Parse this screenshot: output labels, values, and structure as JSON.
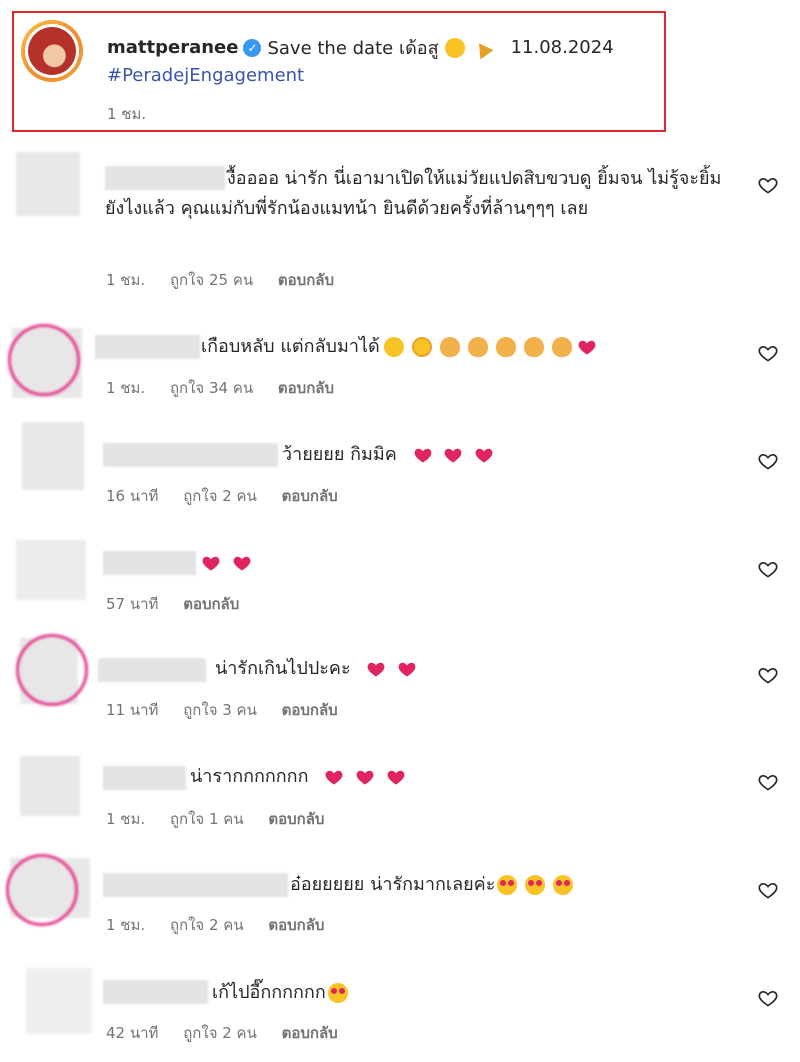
{
  "post": {
    "username": "mattperanee",
    "caption": "Save the date เด้อสู",
    "date": "11.08.2024",
    "hashtag": "#PeradejEngagement",
    "time": "1 ชม."
  },
  "comments": [
    {
      "text": "งื้ออออ น่ารัก นี่เอามาเปิดให้แม่วัยแปดสิบขวบดู ยิ้มจน ไม่รู้จะยิ้มยังไงแล้ว คุณแม่กับพี่รักน้องแมทน้า ยินดีด้วยครั้งที่ล้านๆๆๆ เลย",
      "time": "1 ชม.",
      "likes": "ถูกใจ 25 คน",
      "reply": "ตอบกลับ"
    },
    {
      "text": "เกือบหลับ แต่กลับมาได้",
      "time": "1 ชม.",
      "likes": "ถูกใจ 34 คน",
      "reply": "ตอบกลับ"
    },
    {
      "text": "ว้ายยยย กิมมิค",
      "time": "16 นาที",
      "likes": "ถูกใจ 2 คน",
      "reply": "ตอบกลับ"
    },
    {
      "text": "",
      "time": "57 นาที",
      "likes": "",
      "reply": "ตอบกลับ"
    },
    {
      "text": "น่ารักเกินไปปะคะ",
      "time": "11 นาที",
      "likes": "ถูกใจ 3 คน",
      "reply": "ตอบกลับ"
    },
    {
      "text": "น่ารากกกกกกก",
      "time": "1 ชม.",
      "likes": "ถูกใจ 1 คน",
      "reply": "ตอบกลับ"
    },
    {
      "text": "อ๋อยยยยย น่ารักมากเลยค่ะ",
      "time": "1 ชม.",
      "likes": "ถูกใจ 2 คน",
      "reply": "ตอบกลับ"
    },
    {
      "text": "เก้ไปอี๊กกกกกก",
      "time": "42 นาที",
      "likes": "ถูกใจ 2 คน",
      "reply": "ตอบกลับ"
    }
  ],
  "colors": {
    "heart": "#e0245e",
    "link": "#3a55a7",
    "highlight_border": "#e0262b"
  }
}
